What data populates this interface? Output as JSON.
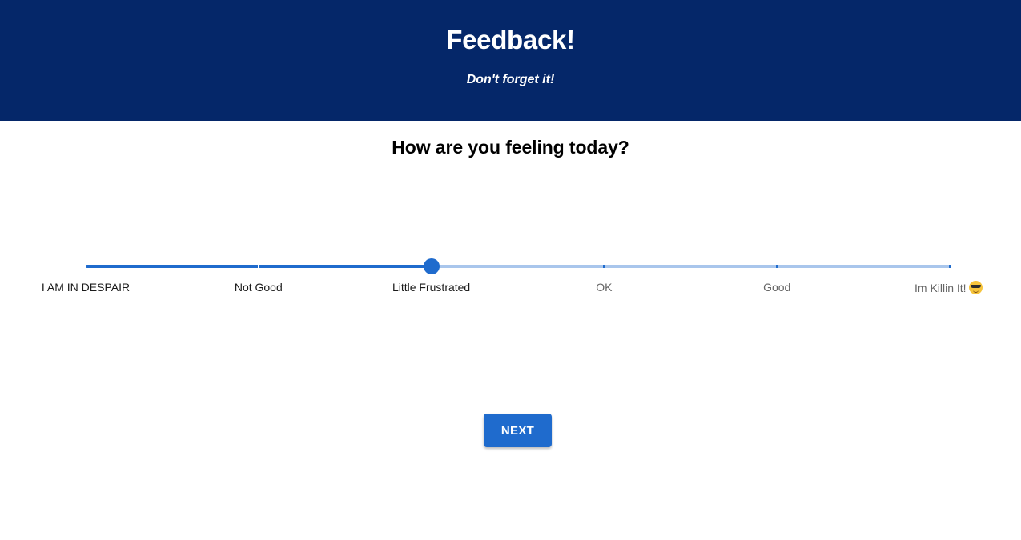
{
  "header": {
    "title": "Feedback!",
    "subtitle": "Don't forget it!",
    "background_color": "#052769"
  },
  "question": "How are you feeling today?",
  "slider": {
    "selected_index": 2,
    "selected_label": "Little Frustrated",
    "accent_color": "#1f6bcd",
    "rail_color": "#a9c6ec",
    "marks": [
      {
        "label": "I AM IN DESPAIR"
      },
      {
        "label": "Not Good"
      },
      {
        "label": "Little Frustrated"
      },
      {
        "label": "OK"
      },
      {
        "label": "Good"
      },
      {
        "label": "Im Killin It!",
        "icon": "smiling-face-with-sunglasses-icon"
      }
    ]
  },
  "next_button": {
    "label": "NEXT"
  }
}
